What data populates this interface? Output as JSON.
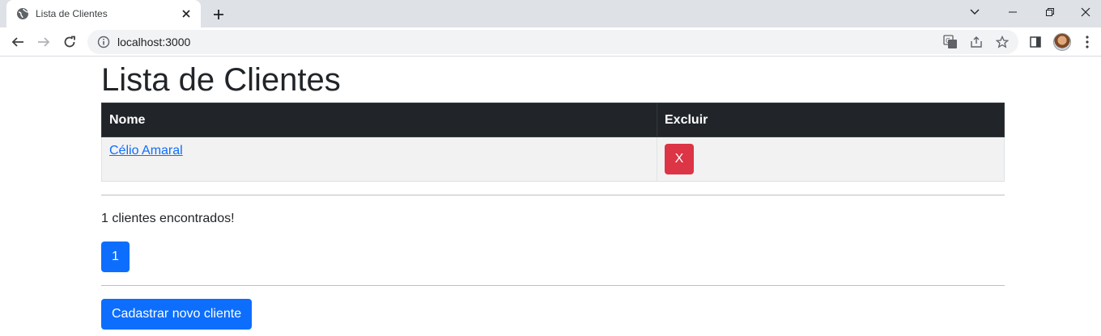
{
  "browser": {
    "tab_title": "Lista de Clientes",
    "url": "localhost:3000"
  },
  "page": {
    "heading": "Lista de Clientes",
    "table": {
      "headers": [
        "Nome",
        "Excluir"
      ],
      "rows": [
        {
          "nome": "Célio Amaral",
          "delete_label": "X"
        }
      ]
    },
    "count_text": "1 clientes encontrados!",
    "pagination": [
      "1"
    ],
    "new_button_label": "Cadastrar novo cliente"
  },
  "colors": {
    "primary": "#0d6efd",
    "danger": "#dc3545",
    "table_header": "#212529"
  }
}
